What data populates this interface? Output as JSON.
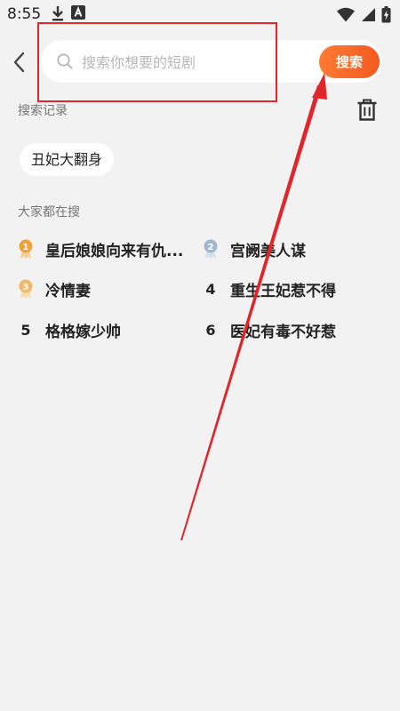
{
  "status_bar": {
    "time": "8:55",
    "icons": [
      "download-icon",
      "keyboard-a-icon",
      "wifi-icon",
      "cell-signal-icon",
      "battery-icon"
    ]
  },
  "search": {
    "placeholder": "搜索你想要的短剧",
    "value": "",
    "button_label": "搜索"
  },
  "history": {
    "title": "搜索记录",
    "items": [
      "丑妃大翻身"
    ]
  },
  "popular": {
    "title": "大家都在搜",
    "items": [
      {
        "rank": "1",
        "title": "皇后娘娘向来有仇..."
      },
      {
        "rank": "2",
        "title": "宫阙美人谋"
      },
      {
        "rank": "3",
        "title": "冷情妻"
      },
      {
        "rank": "4",
        "title": "重生王妃惹不得"
      },
      {
        "rank": "5",
        "title": "格格嫁少帅"
      },
      {
        "rank": "6",
        "title": "医妃有毒不好惹"
      }
    ]
  },
  "colors": {
    "background": "#f2f2f2",
    "accent_orange": "#f45a1f",
    "annotation_red": "#e0262b",
    "rank_gold": "#f0a23a",
    "rank_silver": "#9fb7cf",
    "rank_bronze": "#f1b86a"
  }
}
